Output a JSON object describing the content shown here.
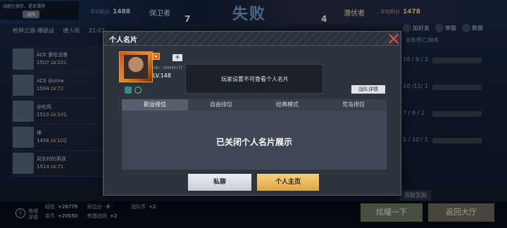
{
  "header": {
    "save_tip": "战绩已保存，是否清除",
    "save_tip_button": "清除",
    "left_avg_label": "平均积分",
    "left_avg_value": "1488",
    "left_team": "保卫者",
    "left_score": "7",
    "result": "失败",
    "right_score": "4",
    "right_team": "潜伏者",
    "right_avg_label": "平均积分",
    "right_avg_value": "1478"
  },
  "mode_row": [
    "枪神之路-爆破战",
    "唐人街",
    "21:03",
    "22:46",
    "11:23:19:38"
  ],
  "right_actions": [
    "加好友",
    "举报",
    "数据"
  ],
  "column_header": "击杀/死亡/助攻",
  "players": [
    {
      "name": "ACE 爱吃没差",
      "rating": "1507",
      "level": "LV.101"
    },
    {
      "name": "ACE @slow",
      "rating": "1504",
      "level": "LV.72"
    },
    {
      "name": "@吃鸡",
      "rating": "1510",
      "level": "LV.101"
    },
    {
      "name": "神",
      "rating": "1456",
      "level": "LV.102"
    },
    {
      "name": "风车村的男孩",
      "rating": "1514",
      "level": "LV.71"
    }
  ],
  "kda_list": [
    "10 / 9 / 3",
    "10 /11/ 1",
    "",
    "7 / 9 / 2",
    "5 / 10 / 1"
  ],
  "bottom": {
    "label_line1": "地域",
    "label_line2": "详情",
    "stats": [
      {
        "label": "经验",
        "value": "+26779"
      },
      {
        "label": "段位分",
        "value": "-8"
      },
      {
        "label": "战队币",
        "value": "+2"
      },
      {
        "label": "金币",
        "value": "+20550"
      },
      {
        "label": "刺激战场",
        "value": "+2"
      },
      {
        "label": "",
        "value": ""
      }
    ],
    "reward_label": "领取奖励",
    "show_off_button": "炫耀一下",
    "back_lobby_button": "返回大厅"
  },
  "modal": {
    "title": "个人名片",
    "uid": "UID：106465177",
    "level": "LV.148",
    "private_notice": "玩家设置不可查看个人名片",
    "team_detail_button": "战队详情",
    "tabs": [
      "职业排位",
      "自由排位",
      "经典模式",
      "荒岛排位"
    ],
    "active_tab": "职业排位",
    "panel_text": "已关闭个人名片展示",
    "chat_button": "私聊",
    "homepage_button": "个人主页"
  }
}
